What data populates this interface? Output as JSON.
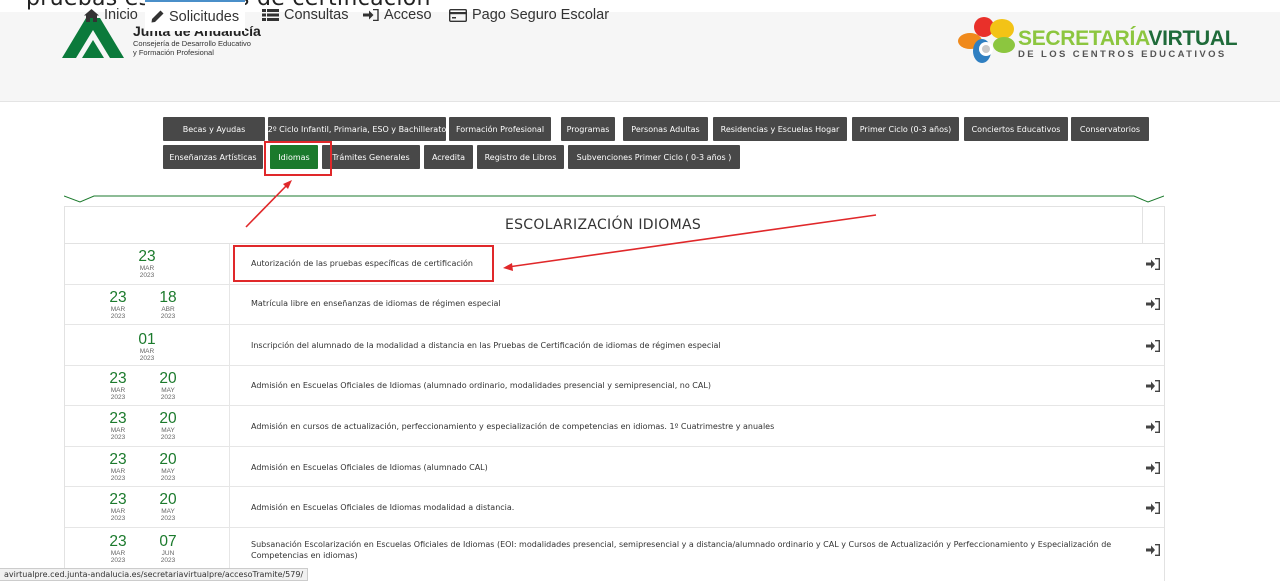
{
  "caption": "pruebas específicas de certificación\"",
  "header": {
    "brand_title": "Junta de Andalucía",
    "brand_sub1": "Consejería de Desarrollo Educativo",
    "brand_sub2": "y Formación Profesional",
    "sv_title_a": "SECRETARÍA",
    "sv_title_b": "VIRTUAL",
    "sv_sub": "DE LOS CENTROS EDUCATIVOS"
  },
  "nav": {
    "items": [
      {
        "label": "Inicio",
        "icon": "home-icon"
      },
      {
        "label": "Solicitudes",
        "icon": "pencil-icon",
        "active": true
      },
      {
        "label": "Consultas",
        "icon": "list-icon"
      },
      {
        "label": "Acceso",
        "icon": "sign-in-icon"
      },
      {
        "label": "Pago Seguro Escolar",
        "icon": "credit-card-icon"
      }
    ]
  },
  "tabs": {
    "row1": [
      "Becas y Ayudas",
      "2º Ciclo Infantil, Primaria, ESO y Bachillerato",
      "Formación Profesional",
      "Programas",
      "Personas Adultas",
      "Residencias y Escuelas Hogar",
      "Primer Ciclo (0-3 años)",
      "Conciertos Educativos",
      "Conservatorios"
    ],
    "row2": [
      "Enseñanzas Artísticas",
      "Idiomas",
      "Trámites Generales",
      "Acredita",
      "Registro de Libros",
      "Subvenciones Primer Ciclo ( 0-3 años )"
    ],
    "active": "Idiomas"
  },
  "panel": {
    "title": "ESCOLARIZACIÓN IDIOMAS"
  },
  "rows": [
    {
      "start": {
        "d": "23",
        "m": "MAR",
        "y": "2023"
      },
      "end": null,
      "text": "Autorización de las pruebas específicas de certificación",
      "highlighted": true
    },
    {
      "start": {
        "d": "23",
        "m": "MAR",
        "y": "2023"
      },
      "end": {
        "d": "18",
        "m": "ABR",
        "y": "2023"
      },
      "text": "Matrícula libre en enseñanzas de idiomas de régimen especial"
    },
    {
      "start": {
        "d": "01",
        "m": "MAR",
        "y": "2023"
      },
      "end": null,
      "text": "Inscripción del alumnado de la modalidad a distancia en las Pruebas de Certificación de idiomas de régimen especial"
    },
    {
      "start": {
        "d": "23",
        "m": "MAR",
        "y": "2023"
      },
      "end": {
        "d": "20",
        "m": "MAY",
        "y": "2023"
      },
      "text": "Admisión en Escuelas Oficiales de Idiomas (alumnado ordinario, modalidades presencial y semipresencial, no CAL)"
    },
    {
      "start": {
        "d": "23",
        "m": "MAR",
        "y": "2023"
      },
      "end": {
        "d": "20",
        "m": "MAY",
        "y": "2023"
      },
      "text": "Admisión en cursos de actualización, perfeccionamiento y especialización de competencias en idiomas. 1º Cuatrimestre y anuales"
    },
    {
      "start": {
        "d": "23",
        "m": "MAR",
        "y": "2023"
      },
      "end": {
        "d": "20",
        "m": "MAY",
        "y": "2023"
      },
      "text": "Admisión en Escuelas Oficiales de Idiomas (alumnado CAL)"
    },
    {
      "start": {
        "d": "23",
        "m": "MAR",
        "y": "2023"
      },
      "end": {
        "d": "20",
        "m": "MAY",
        "y": "2023"
      },
      "text": "Admisión en Escuelas Oficiales de Idiomas modalidad a distancia."
    },
    {
      "start": {
        "d": "23",
        "m": "MAR",
        "y": "2023"
      },
      "end": {
        "d": "07",
        "m": "JUN",
        "y": "2023"
      },
      "text": "Subsanación Escolarización en Escuelas Oficiales de Idiomas (EOI: modalidades presencial, semipresencial y a distancia/alumnado ordinario y CAL y Cursos de Actualización y Perfeccionamiento y Especialización de Competencias en idiomas)"
    }
  ],
  "status_bar": "avirtualpre.ced.junta-andalucia.es/secretariavirtualpre/accesoTramite/579/",
  "colors": {
    "accent_green": "#1b7a2c",
    "tab_dark": "#484848",
    "annotation_red": "#e0282a"
  }
}
